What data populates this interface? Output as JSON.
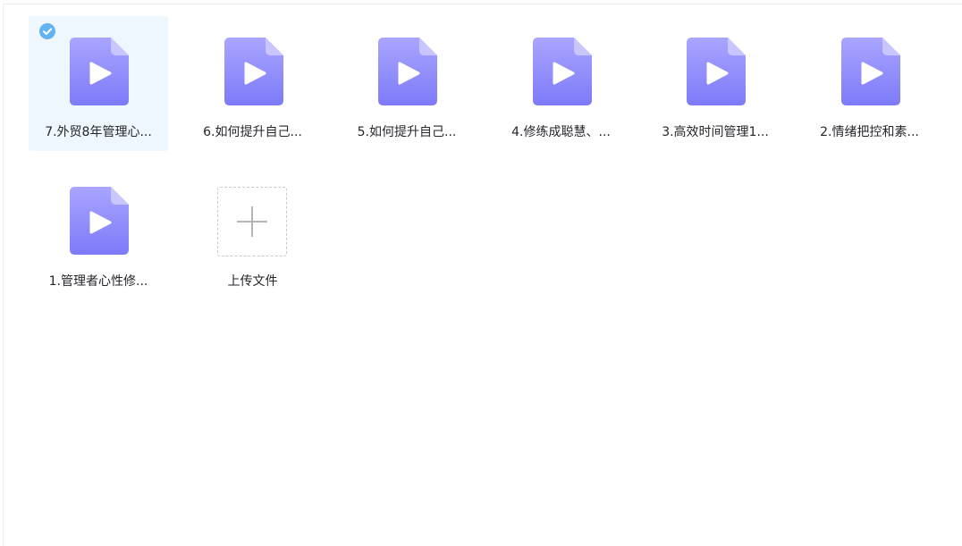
{
  "files": [
    {
      "name": "7.外贸8年管理心...",
      "selected": true
    },
    {
      "name": "6.如何提升自己...",
      "selected": false
    },
    {
      "name": "5.如何提升自己...",
      "selected": false
    },
    {
      "name": "4.修练成聪慧、...",
      "selected": false
    },
    {
      "name": "3.高效时间管理1...",
      "selected": false
    },
    {
      "name": "2.情绪把控和素...",
      "selected": false
    },
    {
      "name": "1.管理者心性修...",
      "selected": false
    }
  ],
  "upload": {
    "label": "上传文件"
  },
  "icons": {
    "file": "video-file-icon",
    "check": "check-circle-icon",
    "plus": "plus-icon"
  },
  "colors": {
    "file_top": "#a9a5ff",
    "file_bottom": "#7d7af9",
    "check": "#63b3f3",
    "selected_bg": "#eef6fe",
    "text": "#25262b",
    "upload_border": "#c9c9c9"
  }
}
